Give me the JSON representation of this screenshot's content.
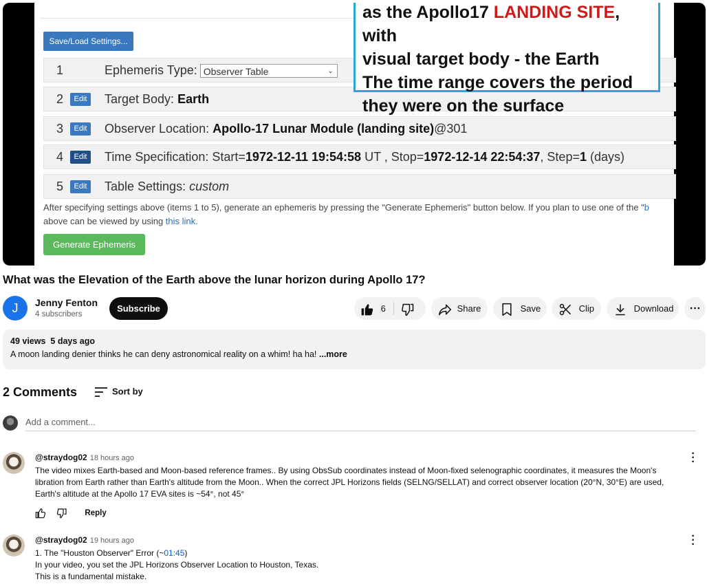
{
  "video": {
    "save_load_label": "Save/Load Settings...",
    "steps": [
      {
        "num": "1",
        "label": "Ephemeris Type:",
        "select_value": "Observer Table"
      },
      {
        "num": "2",
        "edit": "Edit",
        "label": "Target Body:",
        "value": "Earth"
      },
      {
        "num": "3",
        "edit": "Edit",
        "label": "Observer Location:",
        "value": "Apollo-17 Lunar Module (landing site)",
        "suffix": "@301"
      },
      {
        "num": "4",
        "edit": "Edit",
        "label": "Time Specification: Start=",
        "start": "1972-12-11 19:54:58",
        "mid": " UT , Stop=",
        "stop": "1972-12-14 22:54:37",
        "step_label": ", Step=",
        "step": "1",
        "unit": " (days)"
      },
      {
        "num": "5",
        "edit": "Edit",
        "label": "Table Settings:",
        "value": "custom"
      }
    ],
    "instructions_1": "After specifying settings above (items 1 to 5), generate an ephemeris by pressing the \"Generate Ephemeris\" button below. If you plan to use one of the \"",
    "instructions_1_link": "b",
    "instructions_2": "above can be viewed by using ",
    "instructions_2_link": "this link.",
    "generate_label": "Generate Ephemeris",
    "callout": {
      "line1a": "as the Apollo17 ",
      "line1b": "LANDING SITE",
      "line1c": ", with",
      "line2": "visual target body - the Earth",
      "line3": "The time range covers the period",
      "line4": "they were on the surface"
    }
  },
  "title": "What was the Elevation of the Earth above the lunar horizon during Apollo 17?",
  "channel": {
    "avatar_letter": "J",
    "name": "Jenny Fenton",
    "subscribers": "4 subscribers",
    "subscribe_label": "Subscribe"
  },
  "actions": {
    "likes": "6",
    "share": "Share",
    "save": "Save",
    "clip": "Clip",
    "download": "Download"
  },
  "description": {
    "views": "49 views",
    "age": "5 days ago",
    "text": "A moon landing denier thinks he can deny astronomical reality on a whim! ha ha! ",
    "more": "...more"
  },
  "comments_header": {
    "count": "2 Comments",
    "sort": "Sort by",
    "add_placeholder": "Add a comment..."
  },
  "comments": [
    {
      "user": "@straydog02",
      "time": "18 hours ago",
      "lines": [
        "The video mixes Earth-based and Moon-based reference frames.. By using ObsSub coordinates instead of Moon-fixed selenographic coordinates, it measures the Moon's",
        "libration from Earth rather than Earth's altitude from the Moon.. When the correct JPL Horizons fields (SELNG/SELLAT) and correct observer location (20°N, 30°E) are used,",
        "Earth's altitude at the Apollo 17 EVA sites is ~54°, not 45°"
      ],
      "reply": "Reply"
    },
    {
      "user": "@straydog02",
      "time": "19 hours ago",
      "line1a": "1. The \"Houston Observer\" Error (~",
      "timestamp": "01:45",
      "line1b": ")",
      "lines": [
        "In your video, you set the JPL Horizons Observer Location to Houston, Texas.",
        "This is a fundamental mistake."
      ]
    }
  ]
}
